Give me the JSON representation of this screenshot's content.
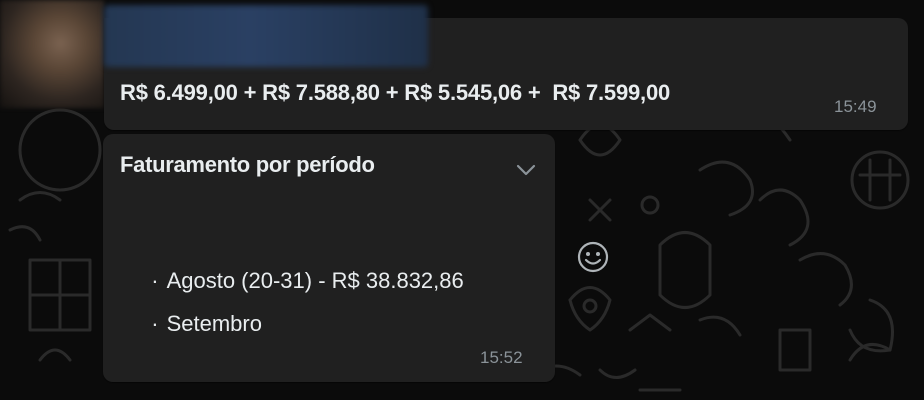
{
  "colors": {
    "background": "#0b0b0b",
    "bubble": "#202020",
    "text": "#e9edef",
    "timestamp": "#8b9399"
  },
  "message_1": {
    "text": "R$ 6.499,00 + R$ 7.588,80 + R$ 5.545,06 +  R$ 7.599,00",
    "time": "15:49"
  },
  "message_2": {
    "title": "Faturamento por período",
    "items": [
      {
        "bullet": "·",
        "text": "Agosto (20-31) - R$ 38.832,86"
      },
      {
        "bullet": "·",
        "text": "Setembro"
      }
    ],
    "time": "15:52"
  },
  "icons": {
    "menu": "chevron-down-icon",
    "react": "emoji-icon"
  }
}
